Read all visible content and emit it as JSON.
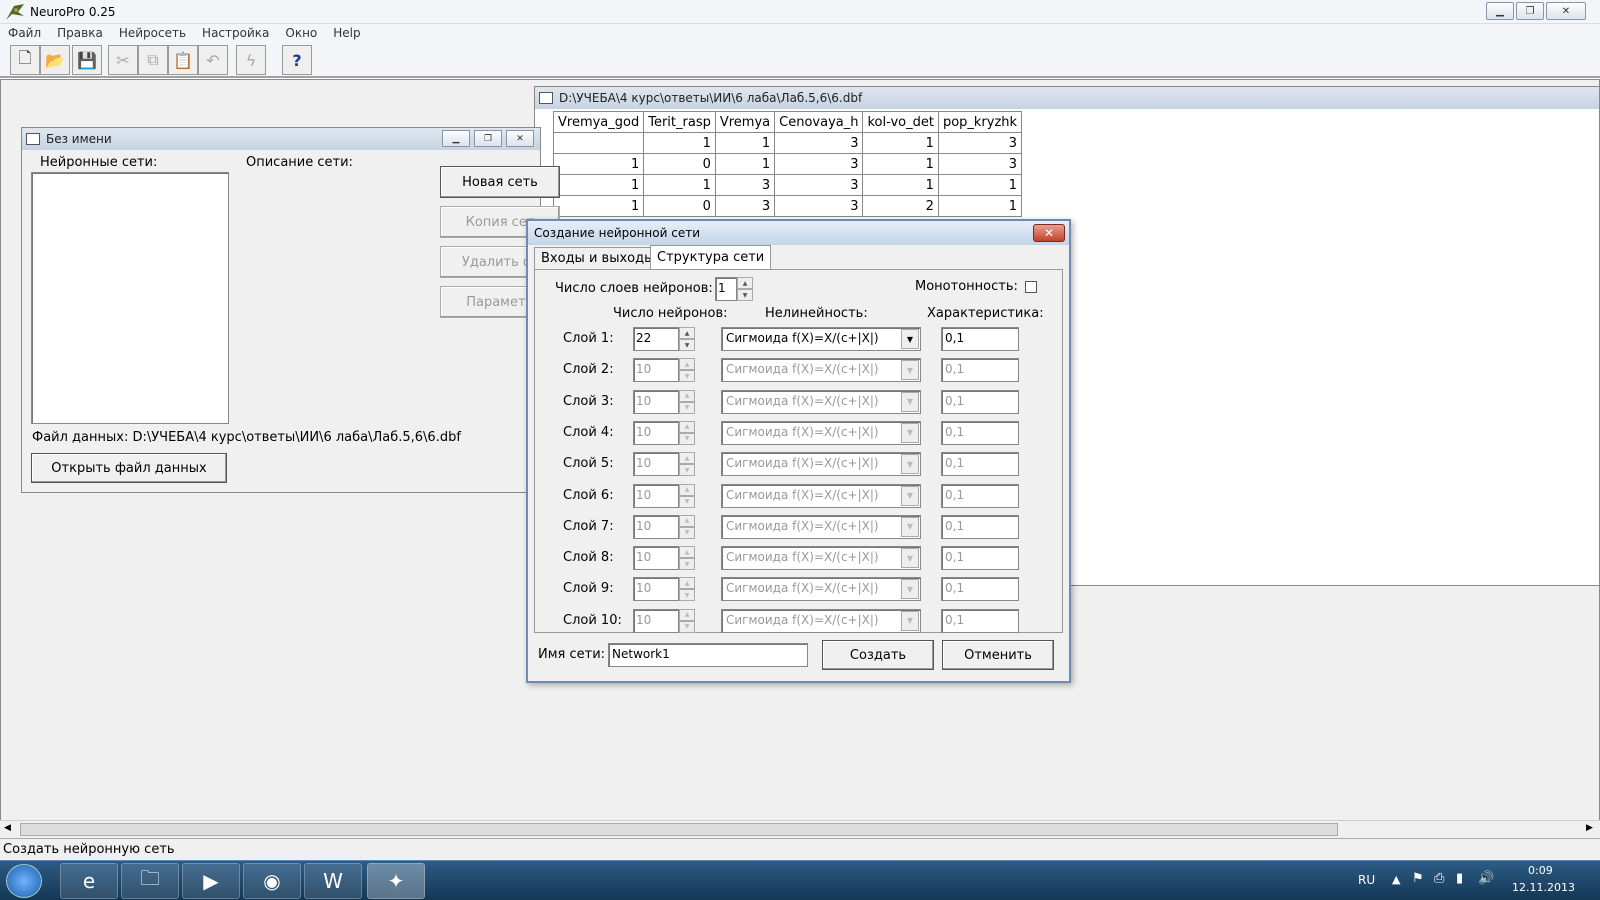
{
  "app": {
    "title": "NeuroPro 0.25"
  },
  "menu": [
    "Файл",
    "Правка",
    "Нейросеть",
    "Настройка",
    "Окно",
    "Help"
  ],
  "toolbar": {
    "icons": [
      "new-file-icon",
      "open-folder-icon",
      "save-icon",
      "cut-icon",
      "copy-icon",
      "paste-icon",
      "undo-icon",
      "run-icon",
      "help-icon"
    ],
    "help_glyph": "?"
  },
  "noname_window": {
    "title": "Без имени",
    "networks_label": "Нейронные сети:",
    "description_label": "Описание сети:",
    "btn_new": "Новая сеть",
    "btn_copy": "Копия сет",
    "btn_delete": "Удалить се",
    "btn_params": "Параметр",
    "data_file": "Файл данных: D:\\УЧЕБА\\4 курс\\ответы\\ИИ\\6 лаба\\Лаб.5,6\\6.dbf",
    "btn_open": "Открыть файл данных"
  },
  "table_window": {
    "title": "D:\\УЧЕБА\\4 курс\\ответы\\ИИ\\6 лаба\\Лаб.5,6\\6.dbf",
    "columns": [
      "Vremya_god",
      "Terit_rasp",
      "Vremya",
      "Cenovaya_h",
      "kol-vo_det",
      "pop_kryzhk"
    ],
    "rows": [
      [
        "",
        "1",
        "1",
        "3",
        "1",
        "3"
      ],
      [
        "1",
        "0",
        "1",
        "3",
        "1",
        "3"
      ],
      [
        "1",
        "1",
        "3",
        "3",
        "1",
        "1"
      ],
      [
        "1",
        "0",
        "3",
        "3",
        "2",
        "1"
      ]
    ]
  },
  "dialog": {
    "title": "Создание нейронной сети",
    "tab1": "Входы и выходы",
    "tab2": "Структура сети",
    "layers_count_label": "Число слоев нейронов:",
    "layers_count": "1",
    "monotone_label": "Монотонность:",
    "col_neurons": "Число нейронов:",
    "col_nonlin": "Нелинейность:",
    "col_char": "Характеристика:",
    "layers": [
      {
        "label": "Слой 1:",
        "neurons": "22",
        "func": "Сигмоида  f(X)=X/(c+|X|)",
        "char": "0,1"
      },
      {
        "label": "Слой 2:",
        "neurons": "10",
        "func": "Сигмоида  f(X)=X/(c+|X|)",
        "char": "0,1"
      },
      {
        "label": "Слой 3:",
        "neurons": "10",
        "func": "Сигмоида  f(X)=X/(c+|X|)",
        "char": "0,1"
      },
      {
        "label": "Слой 4:",
        "neurons": "10",
        "func": "Сигмоида  f(X)=X/(c+|X|)",
        "char": "0,1"
      },
      {
        "label": "Слой 5:",
        "neurons": "10",
        "func": "Сигмоида  f(X)=X/(c+|X|)",
        "char": "0,1"
      },
      {
        "label": "Слой 6:",
        "neurons": "10",
        "func": "Сигмоида  f(X)=X/(c+|X|)",
        "char": "0,1"
      },
      {
        "label": "Слой 7:",
        "neurons": "10",
        "func": "Сигмоида  f(X)=X/(c+|X|)",
        "char": "0,1"
      },
      {
        "label": "Слой 8:",
        "neurons": "10",
        "func": "Сигмоида  f(X)=X/(c+|X|)",
        "char": "0,1"
      },
      {
        "label": "Слой 9:",
        "neurons": "10",
        "func": "Сигмоида  f(X)=X/(c+|X|)",
        "char": "0,1"
      },
      {
        "label": "Слой 10:",
        "neurons": "10",
        "func": "Сигмоида  f(X)=X/(c+|X|)",
        "char": "0,1"
      }
    ],
    "name_label": "Имя сети:",
    "name_value": "Network1",
    "btn_create": "Создать",
    "btn_cancel": "Отменить"
  },
  "status": "Создать нейронную сеть",
  "tray": {
    "lang": "RU",
    "time": "0:09",
    "date": "12.11.2013"
  }
}
